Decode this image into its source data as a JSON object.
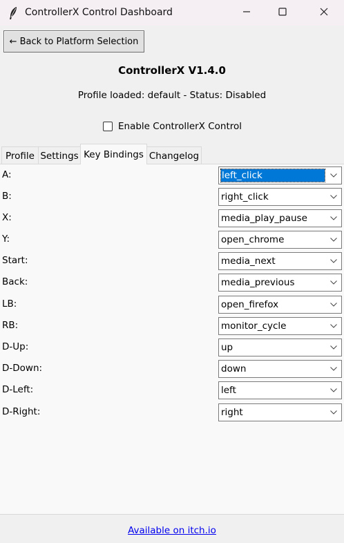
{
  "window": {
    "title": "ControllerX Control Dashboard",
    "icon": "feather-icon",
    "controls": [
      "minimize-icon",
      "maximize-icon",
      "close-icon"
    ]
  },
  "toolbar": {
    "back_label": "← Back to Platform Selection"
  },
  "header": {
    "version": "ControllerX V1.4.0",
    "status": "Profile loaded: default - Status: Disabled"
  },
  "enable": {
    "label": "Enable ControllerX Control",
    "checked": false
  },
  "tabs": [
    {
      "label": "Profile",
      "active": false
    },
    {
      "label": "Settings",
      "active": false
    },
    {
      "label": "Key Bindings",
      "active": true
    },
    {
      "label": "Changelog",
      "active": false
    }
  ],
  "bindings": [
    {
      "label": "A:",
      "value": "left_click"
    },
    {
      "label": "B:",
      "value": "right_click"
    },
    {
      "label": "X:",
      "value": "media_play_pause"
    },
    {
      "label": "Y:",
      "value": "open_chrome"
    },
    {
      "label": "Start:",
      "value": "media_next"
    },
    {
      "label": "Back:",
      "value": "media_previous"
    },
    {
      "label": "LB:",
      "value": "open_firefox"
    },
    {
      "label": "RB:",
      "value": "monitor_cycle"
    },
    {
      "label": "D-Up:",
      "value": "up"
    },
    {
      "label": "D-Down:",
      "value": "down"
    },
    {
      "label": "D-Left:",
      "value": "left"
    },
    {
      "label": "D-Right:",
      "value": "right"
    }
  ],
  "footer": {
    "link_text": "Available on itch.io"
  },
  "colors": {
    "titlebar": "#f5eef3",
    "background": "#f0f0f0",
    "selection": "#0078d7",
    "link": "#0000ee"
  }
}
